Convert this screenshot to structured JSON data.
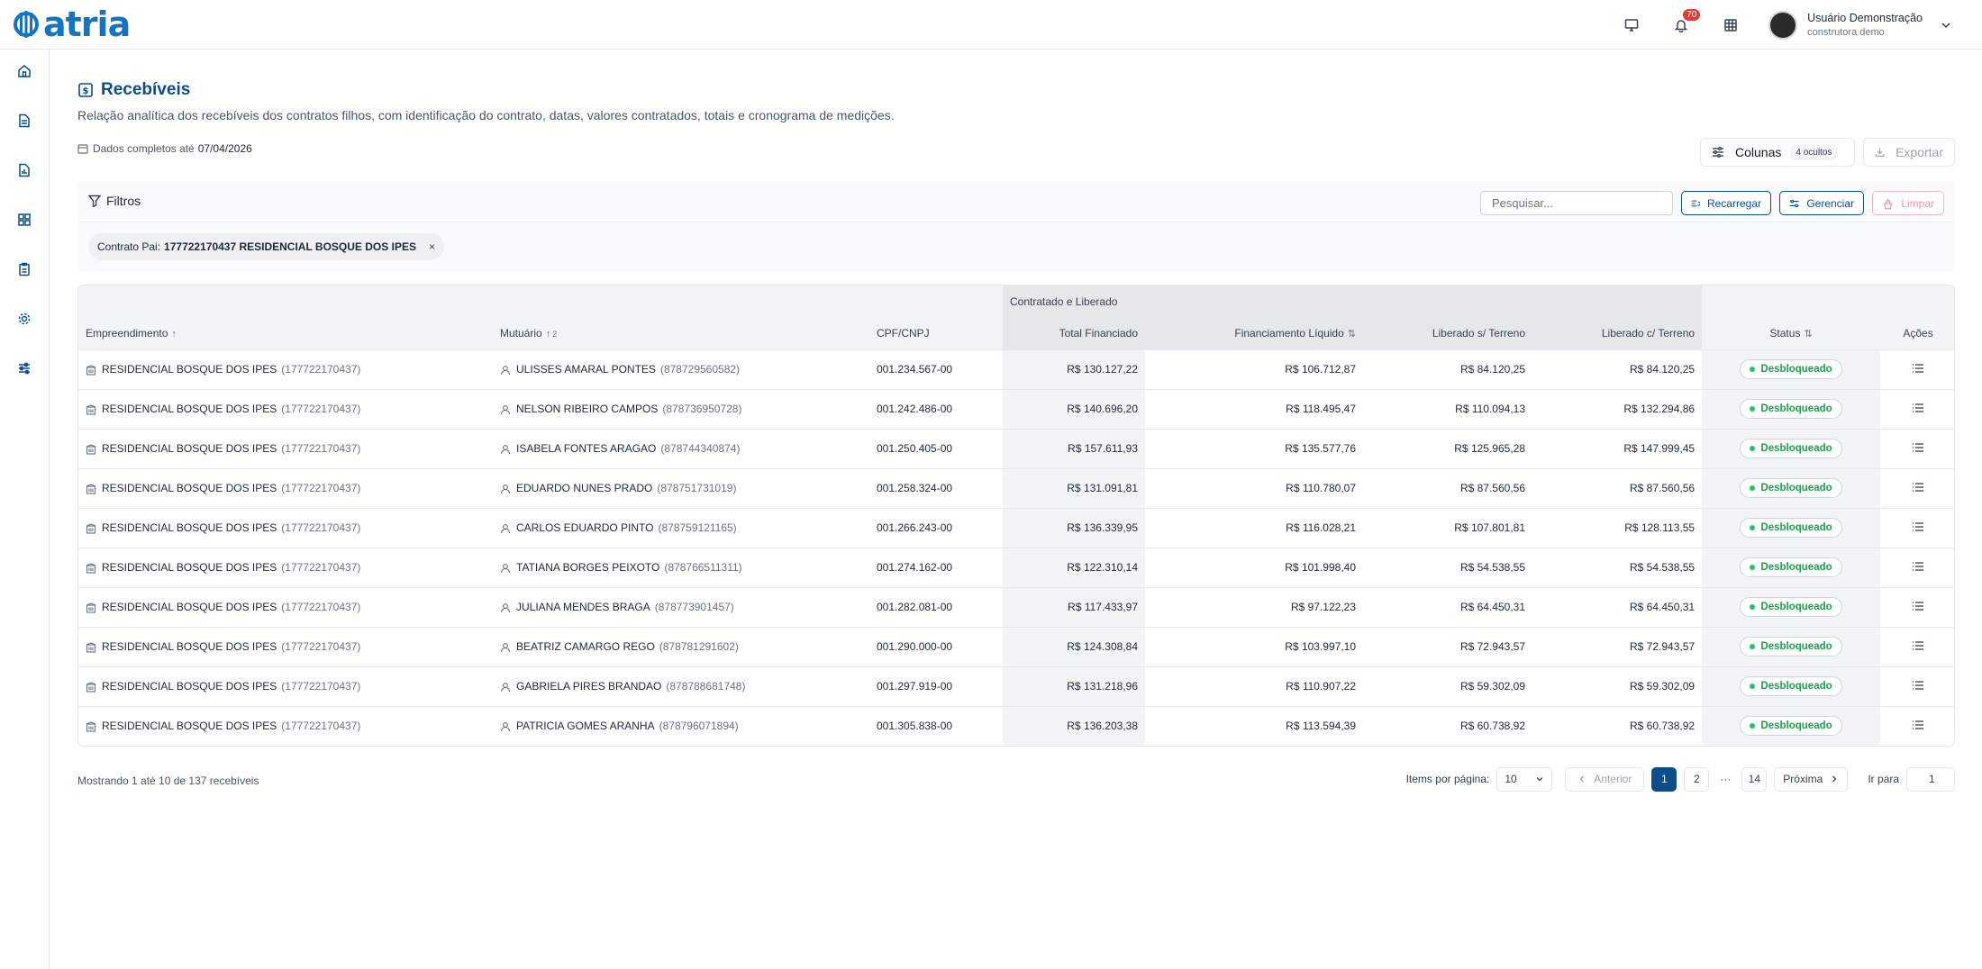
{
  "brand": {
    "name": "atria",
    "color": "#1473c2"
  },
  "header": {
    "notification_count": "70",
    "user_name": "Usuário Demonstração",
    "user_company": "construtora demo"
  },
  "sidebar": {
    "items": [
      {
        "icon": "home-icon"
      },
      {
        "icon": "document-icon"
      },
      {
        "icon": "report-icon"
      },
      {
        "icon": "grid-icon"
      },
      {
        "icon": "clipboard-icon"
      },
      {
        "icon": "gear-icon"
      },
      {
        "icon": "sliders-icon"
      }
    ]
  },
  "page": {
    "title": "Recebíveis",
    "subtitle": "Relação analítica dos recebíveis dos contratos filhos, com identificação do contrato, datas, valores contratados, totais e cronograma de medições.",
    "data_note_prefix": "Dados completos até",
    "data_note_date": "07/04/2026"
  },
  "toolbar": {
    "columns_label": "Colunas",
    "columns_hidden": "4 ocultos",
    "export_label": "Exportar"
  },
  "filters": {
    "label": "Filtros",
    "search_placeholder": "Pesquisar...",
    "reload_label": "Recarregar",
    "manage_label": "Gerenciar",
    "clear_label": "Limpar",
    "chip_key": "Contrato Pai:",
    "chip_value": "177722170437 RESIDENCIAL BOSQUE DOS IPES",
    "chip_close": "×"
  },
  "table": {
    "group_header": "Contratado e Liberado",
    "columns": {
      "empreendimento": "Empreendimento",
      "mutuario": "Mutuário",
      "mutuario_sort_order": "2",
      "cpf": "CPF/CNPJ",
      "total": "Total Financiado",
      "liquido": "Financiamento Líquido",
      "sem_terreno": "Liberado s/ Terreno",
      "com_terreno": "Liberado c/ Terreno",
      "status": "Status",
      "acoes": "Ações"
    },
    "rows": [
      {
        "emp": "RESIDENCIAL BOSQUE DOS IPES",
        "emp_id": "(177722170437)",
        "mut": "ULISSES AMARAL PONTES",
        "mut_id": "(878729560582)",
        "cpf": "001.234.567-00",
        "total": "R$ 130.127,22",
        "liquido": "R$ 106.712,87",
        "sem": "R$ 84.120,25",
        "com": "R$ 84.120,25",
        "status": "Desbloqueado"
      },
      {
        "emp": "RESIDENCIAL BOSQUE DOS IPES",
        "emp_id": "(177722170437)",
        "mut": "NELSON RIBEIRO CAMPOS",
        "mut_id": "(878736950728)",
        "cpf": "001.242.486-00",
        "total": "R$ 140.696,20",
        "liquido": "R$ 118.495,47",
        "sem": "R$ 110.094,13",
        "com": "R$ 132.294,86",
        "status": "Desbloqueado"
      },
      {
        "emp": "RESIDENCIAL BOSQUE DOS IPES",
        "emp_id": "(177722170437)",
        "mut": "ISABELA FONTES ARAGAO",
        "mut_id": "(878744340874)",
        "cpf": "001.250.405-00",
        "total": "R$ 157.611,93",
        "liquido": "R$ 135.577,76",
        "sem": "R$ 125.965,28",
        "com": "R$ 147.999,45",
        "status": "Desbloqueado"
      },
      {
        "emp": "RESIDENCIAL BOSQUE DOS IPES",
        "emp_id": "(177722170437)",
        "mut": "EDUARDO NUNES PRADO",
        "mut_id": "(878751731019)",
        "cpf": "001.258.324-00",
        "total": "R$ 131.091,81",
        "liquido": "R$ 110.780,07",
        "sem": "R$ 87.560,56",
        "com": "R$ 87.560,56",
        "status": "Desbloqueado"
      },
      {
        "emp": "RESIDENCIAL BOSQUE DOS IPES",
        "emp_id": "(177722170437)",
        "mut": "CARLOS EDUARDO PINTO",
        "mut_id": "(878759121165)",
        "cpf": "001.266.243-00",
        "total": "R$ 136.339,95",
        "liquido": "R$ 116.028,21",
        "sem": "R$ 107.801,81",
        "com": "R$ 128.113,55",
        "status": "Desbloqueado"
      },
      {
        "emp": "RESIDENCIAL BOSQUE DOS IPES",
        "emp_id": "(177722170437)",
        "mut": "TATIANA BORGES PEIXOTO",
        "mut_id": "(878766511311)",
        "cpf": "001.274.162-00",
        "total": "R$ 122.310,14",
        "liquido": "R$ 101.998,40",
        "sem": "R$ 54.538,55",
        "com": "R$ 54.538,55",
        "status": "Desbloqueado"
      },
      {
        "emp": "RESIDENCIAL BOSQUE DOS IPES",
        "emp_id": "(177722170437)",
        "mut": "JULIANA MENDES BRAGA",
        "mut_id": "(878773901457)",
        "cpf": "001.282.081-00",
        "total": "R$ 117.433,97",
        "liquido": "R$ 97.122,23",
        "sem": "R$ 64.450,31",
        "com": "R$ 64.450,31",
        "status": "Desbloqueado"
      },
      {
        "emp": "RESIDENCIAL BOSQUE DOS IPES",
        "emp_id": "(177722170437)",
        "mut": "BEATRIZ CAMARGO REGO",
        "mut_id": "(878781291602)",
        "cpf": "001.290.000-00",
        "total": "R$ 124.308,84",
        "liquido": "R$ 103.997,10",
        "sem": "R$ 72.943,57",
        "com": "R$ 72.943,57",
        "status": "Desbloqueado"
      },
      {
        "emp": "RESIDENCIAL BOSQUE DOS IPES",
        "emp_id": "(177722170437)",
        "mut": "GABRIELA PIRES BRANDAO",
        "mut_id": "(878788681748)",
        "cpf": "001.297.919-00",
        "total": "R$ 131.218,96",
        "liquido": "R$ 110.907,22",
        "sem": "R$ 59.302,09",
        "com": "R$ 59.302,09",
        "status": "Desbloqueado"
      },
      {
        "emp": "RESIDENCIAL BOSQUE DOS IPES",
        "emp_id": "(177722170437)",
        "mut": "PATRICIA GOMES ARANHA",
        "mut_id": "(878796071894)",
        "cpf": "001.305.838-00",
        "total": "R$ 136.203,38",
        "liquido": "R$ 113.594,39",
        "sem": "R$ 60.738,92",
        "com": "R$ 60.738,92",
        "status": "Desbloqueado"
      }
    ]
  },
  "pagination": {
    "showing": "Mostrando 1 até 10 de 137 recebíveis",
    "per_page_label": "Items por página:",
    "per_page_value": "10",
    "prev_label": "Anterior",
    "pages": [
      "1",
      "2"
    ],
    "ellipsis": "···",
    "last_page": "14",
    "next_label": "Próxima",
    "goto_label": "Ir para",
    "goto_value": "1"
  }
}
